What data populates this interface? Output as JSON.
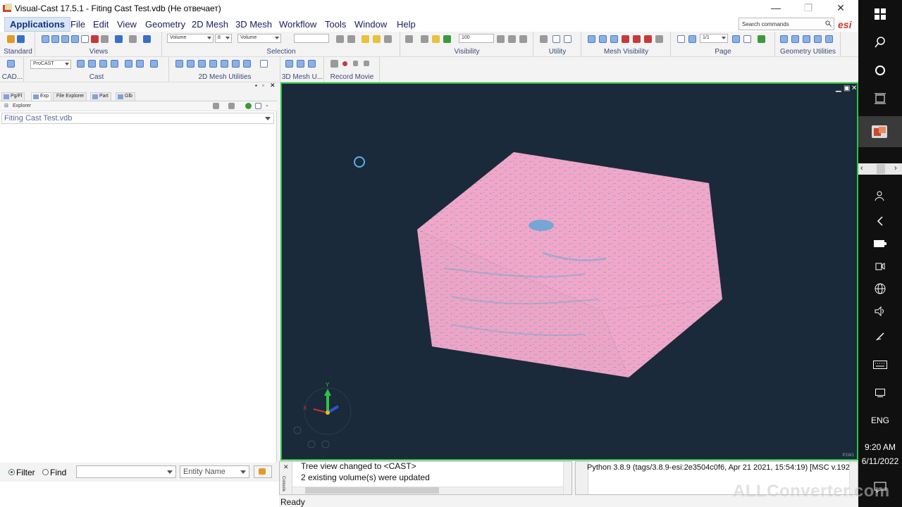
{
  "window": {
    "title": "Visual-Cast 17.5.1 - Fiting Cast Test.vdb (Не отвечает)",
    "minimize": "—",
    "maximize": "❐",
    "close": "✕"
  },
  "menu": {
    "applications": "Applications",
    "items": [
      "File",
      "Edit",
      "View",
      "Geometry",
      "2D Mesh",
      "3D Mesh",
      "Workflow",
      "Tools",
      "Window",
      "Help"
    ],
    "search_placeholder": "Search commands"
  },
  "ribbon1": {
    "groups": [
      "Standard",
      "Views",
      "Selection",
      "Visibility",
      "Utility",
      "Mesh Visibility",
      "Page",
      "Geometry Utilities"
    ],
    "selection_combo1": "Volume",
    "selection_combo2": "8",
    "selection_combo3": "Volume",
    "visibility_value": "100",
    "page_value": "1/1"
  },
  "ribbon2": {
    "groups": [
      "CAD...",
      "Cast",
      "2D Mesh Utilities",
      "3D Mesh U...",
      "Record Movie"
    ],
    "cast_combo": "ProCAST"
  },
  "left_panel": {
    "tabs": [
      "Pg/Fl",
      "Exp",
      "File Explorer",
      "Part",
      "Glb"
    ],
    "explorer_title": "Explorer",
    "tree_value": "Fiting Cast Test.vdb",
    "filter_label": "Filter",
    "find_label": "Find",
    "entity_combo": "Entity Name"
  },
  "viewport": {
    "tag": "P1W1",
    "axis_x": "X",
    "axis_y": "Y"
  },
  "log": {
    "side_label": "Console",
    "lines": [
      "Tree view changed to <CAST>",
      "2 existing volume(s) were updated"
    ],
    "python": "Python 3.8.9 (tags/3.8.9-esi:2e3504c0f6, Apr 21 2021, 15:54:19) [MSC v.1927"
  },
  "status": {
    "text": "Ready"
  },
  "taskbar": {
    "lang": "ENG",
    "time": "9:20 AM",
    "date": "6/11/2022"
  },
  "watermark": "ALLConverter.com",
  "colors": {
    "viewport_bg": "#1a2a3a",
    "viewport_border": "#2ec442",
    "mesh_pink": "#f2a6c8",
    "mesh_speckle": "#58a6d8"
  }
}
